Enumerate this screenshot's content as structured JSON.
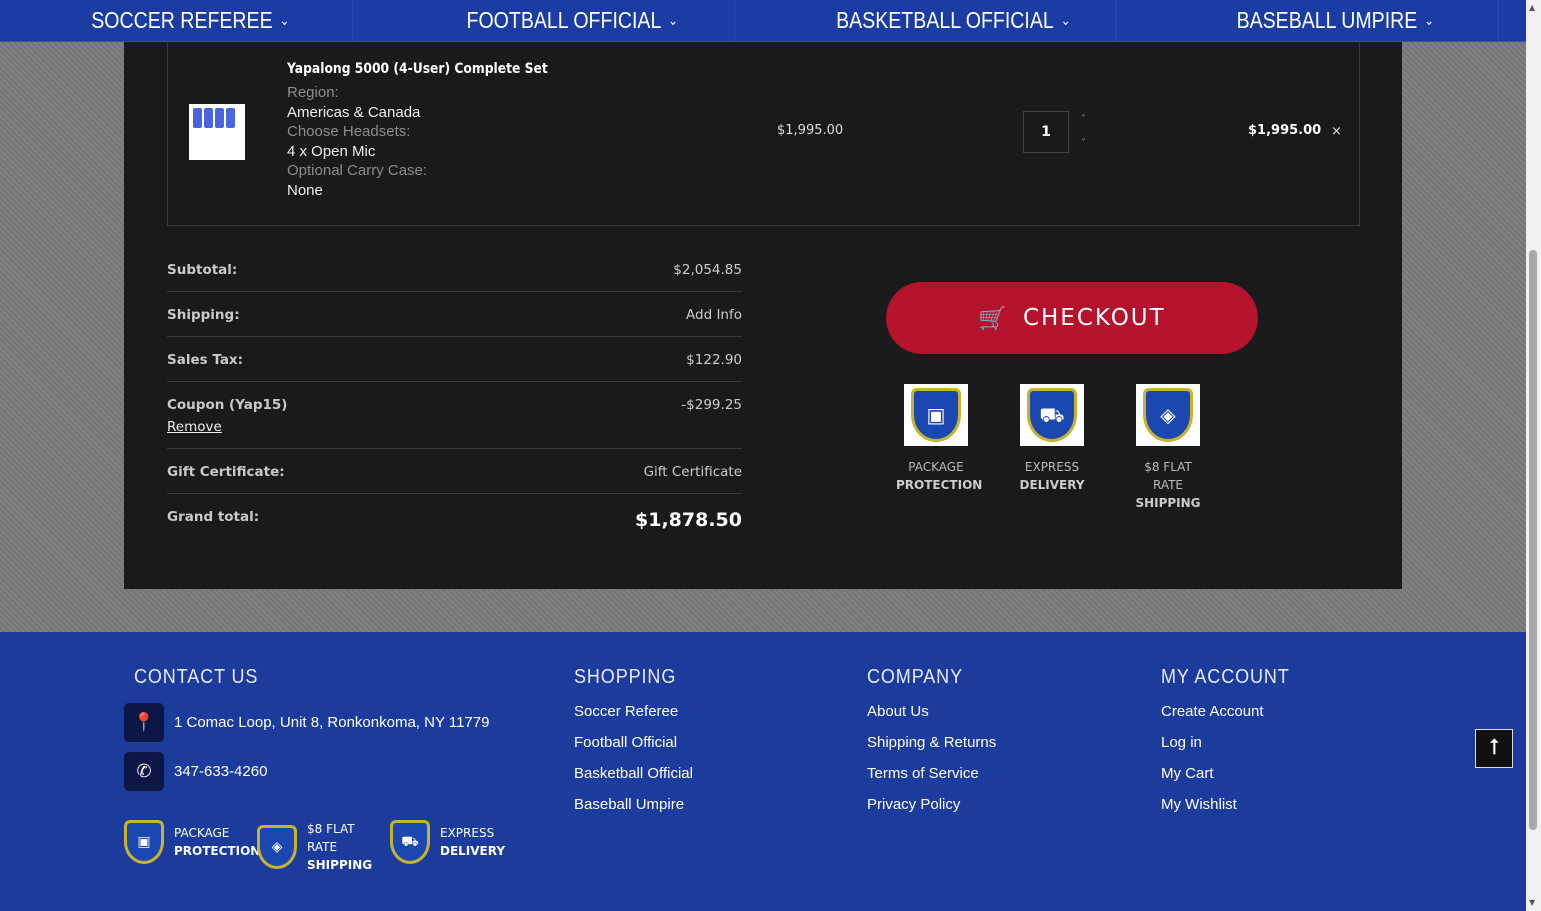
{
  "nav": [
    "SOCCER REFEREE",
    "FOOTBALL OFFICIAL",
    "BASKETBALL OFFICIAL",
    "BASEBALL UMPIRE"
  ],
  "item": {
    "name": "Yapalong 5000 (4-User) Complete Set",
    "options": [
      {
        "label": "Region:",
        "value": "Americas & Canada"
      },
      {
        "label": "Choose Headsets:",
        "value": "4 x Open Mic"
      },
      {
        "label": "Optional Carry Case:",
        "value": "None"
      }
    ],
    "price": "$1,995.00",
    "qty": "1",
    "total": "$1,995.00",
    "remove": "×"
  },
  "summary": {
    "subtotal_label": "Subtotal:",
    "subtotal": "$2,054.85",
    "shipping_label": "Shipping:",
    "shipping": "Add Info",
    "tax_label": "Sales Tax:",
    "tax": "$122.90",
    "coupon_label": "Coupon (Yap15)",
    "coupon": "-$299.25",
    "remove": "Remove",
    "gift_label": "Gift Certificate:",
    "gift": "Gift Certificate",
    "grand_label": "Grand total:",
    "grand": "$1,878.50"
  },
  "checkout": "CHECKOUT",
  "badges": [
    {
      "top": "PACKAGE",
      "bottom": "PROTECTION"
    },
    {
      "top": "EXPRESS",
      "bottom": "DELIVERY"
    },
    {
      "top": "$8 FLAT RATE",
      "bottom": "SHIPPING"
    }
  ],
  "footer": {
    "contact_title": "CONTACT US",
    "address": "1 Comac Loop, Unit 8, Ronkonkoma, NY 11779",
    "phone": "347-633-4260",
    "badges": [
      {
        "top": "PACKAGE",
        "bottom": "PROTECTION"
      },
      {
        "top": "$8 FLAT RATE",
        "bottom": "SHIPPING"
      },
      {
        "top": "EXPRESS",
        "bottom": "DELIVERY"
      }
    ],
    "shopping_title": "SHOPPING",
    "shopping": [
      "Soccer Referee",
      "Football Official",
      "Basketball Official",
      "Baseball Umpire"
    ],
    "company_title": "COMPANY",
    "company": [
      "About Us",
      "Shipping & Returns",
      "Terms of Service",
      "Privacy Policy"
    ],
    "account_title": "MY ACCOUNT",
    "account": [
      "Create Account",
      "Log in",
      "My Cart",
      "My Wishlist"
    ]
  },
  "colors": {
    "nav": "#1b3da3",
    "checkout": "#b5122e",
    "panel": "#1a1a1b"
  }
}
